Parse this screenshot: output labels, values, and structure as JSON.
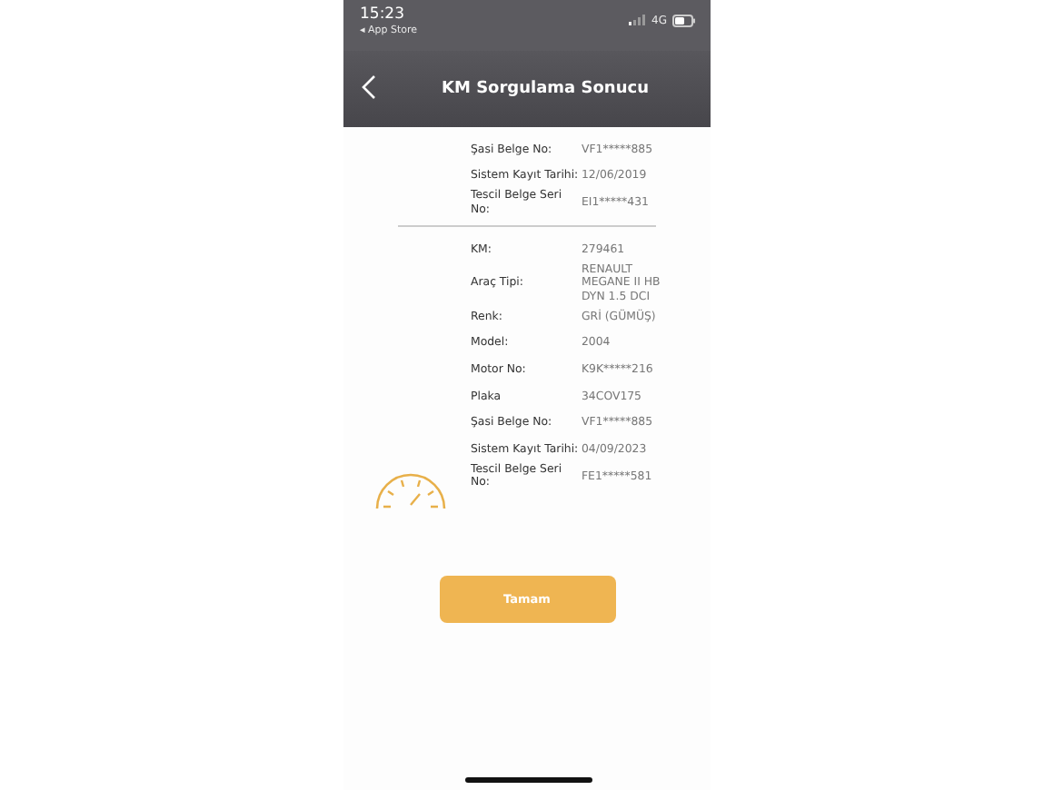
{
  "status_bar": {
    "time": "15:23",
    "back_label": "◂ App Store",
    "network": "4G"
  },
  "nav": {
    "title": "KM Sorgulama Sonucu"
  },
  "groups": [
    {
      "rows": [
        {
          "label": "Şasi Belge No:",
          "value": "VF1*****885"
        },
        {
          "label": "Sistem Kayıt Tarihi:",
          "value": "12/06/2019"
        },
        {
          "label": "Tescil Belge Seri No:",
          "value": "EI1*****431"
        }
      ]
    },
    {
      "rows": [
        {
          "label": "KM:",
          "value": "279461"
        },
        {
          "label": "Araç Tipi:",
          "value": "RENAULT MEGANE II HB DYN 1.5 DCI"
        },
        {
          "label": "Renk:",
          "value": "GRİ (GÜMÜŞ)"
        },
        {
          "label": "Model:",
          "value": "2004"
        },
        {
          "label": "Motor No:",
          "value": "K9K*****216"
        },
        {
          "label": "Plaka",
          "value": "34COV175"
        },
        {
          "label": "Şasi Belge No:",
          "value": "VF1*****885"
        },
        {
          "label": "Sistem Kayıt Tarihi:",
          "value": "04/09/2023"
        },
        {
          "label": "Tescil Belge Seri No:",
          "value": "FE1*****581"
        }
      ]
    }
  ],
  "button": {
    "label": "Tamam"
  }
}
